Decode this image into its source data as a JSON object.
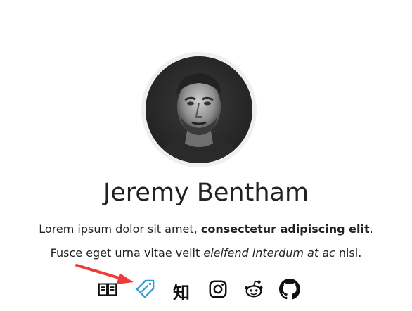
{
  "profile": {
    "name": "Jeremy Bentham",
    "bio_line1": {
      "plain": "Lorem ipsum dolor sit amet, ",
      "bold": "consectetur adipiscing elit",
      "end": "."
    },
    "bio_line2": {
      "plain": "Fusce eget urna vitae velit ",
      "italic": "eleifend interdum at ac",
      "end": " nisi."
    }
  },
  "social": {
    "zhihu_glyph": "知",
    "icons": [
      "book-icon",
      "tag-icon",
      "zhihu-icon",
      "instagram-icon",
      "reddit-icon",
      "github-icon"
    ],
    "active_color": "#2a9bd1",
    "icon_color": "#111111"
  },
  "annotation": {
    "arrow_color": "#f03a3a"
  }
}
